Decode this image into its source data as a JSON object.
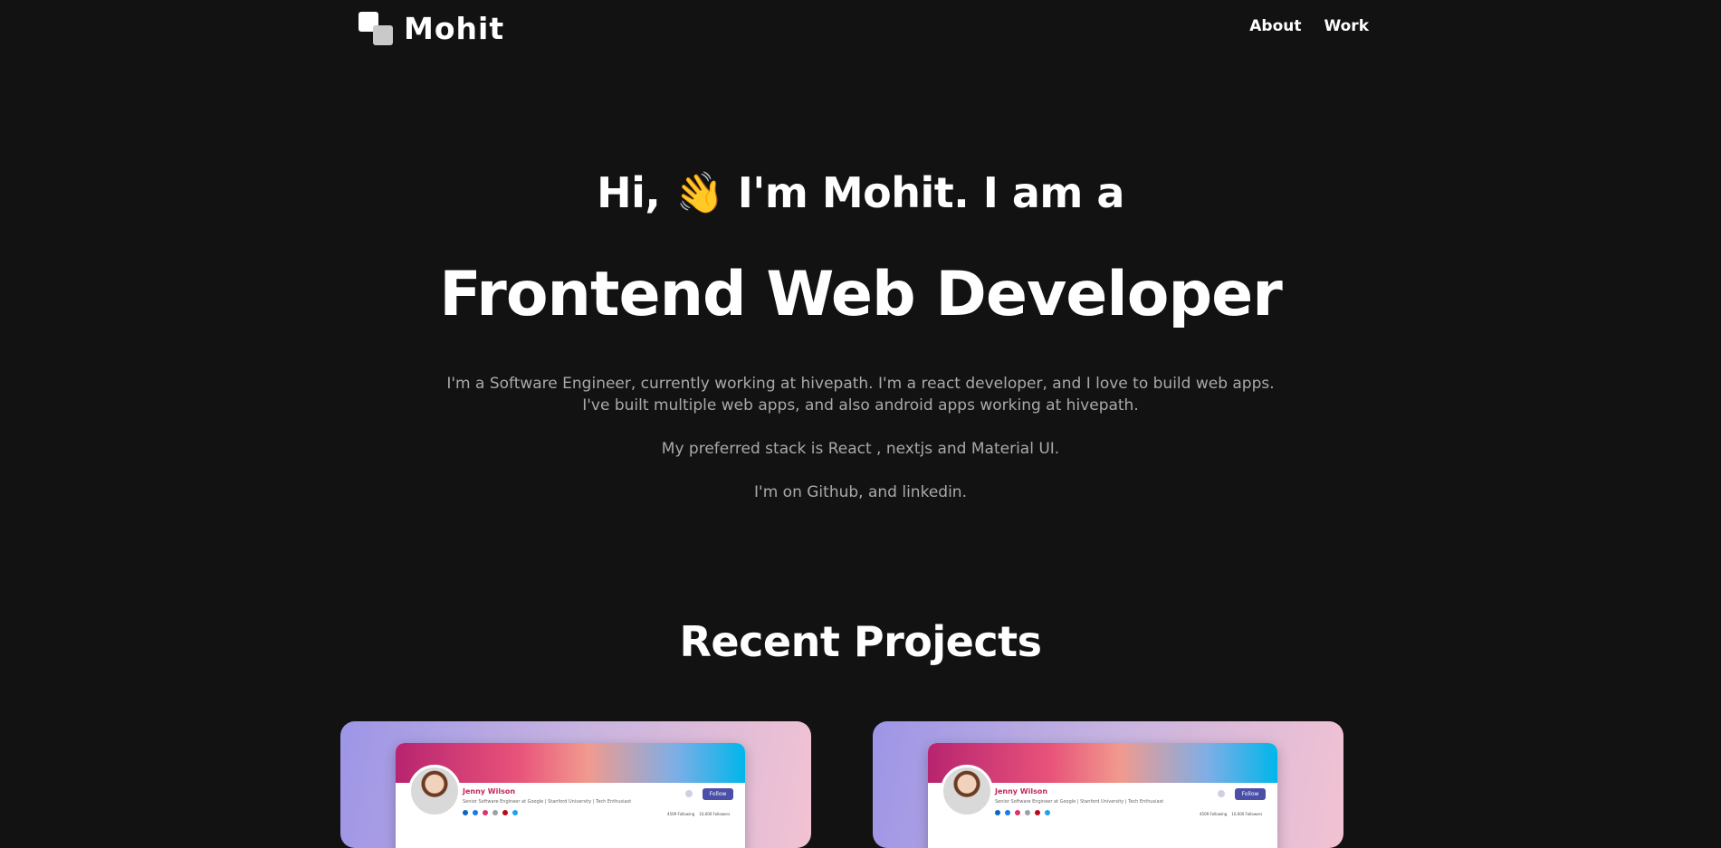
{
  "nav": {
    "logo_text": "Mohit",
    "links": [
      "About",
      "Work"
    ]
  },
  "hero": {
    "greeting_start": "Hi,",
    "wave_emoji": "👋",
    "greeting_end": "I'm Mohit. I am a",
    "role": "Frontend Web Developer",
    "bio_line_1": "I'm a Software Engineer, currently working at hivepath. I'm a react developer, and I love to build web apps.",
    "bio_line_2": "I've built multiple web apps, and also android apps working at hivepath.",
    "stack_line": "My preferred stack is React , nextjs and Material UI.",
    "social_line": "I'm on Github, and linkedin."
  },
  "projects": {
    "title": "Recent Projects",
    "cards": [
      {
        "profile_name": "Jenny Wilson",
        "profile_desc": "Senior Software Engineer at Google | Stanford University | Tech Enthusiast",
        "follow_label": "Follow",
        "following": "4509 Following",
        "followers": "10,000 Followers"
      },
      {
        "profile_name": "Jenny Wilson",
        "profile_desc": "Senior Software Engineer at Google | Stanford University | Tech Enthusiast",
        "follow_label": "Follow",
        "following": "4509 Following",
        "followers": "10,000 Followers"
      }
    ]
  },
  "colors": {
    "background": "#121212",
    "text": "#ffffff",
    "muted_text": "#a9a9a9",
    "card_gradient_start": "#9d95e6",
    "card_gradient_end": "#f2c2d2"
  }
}
